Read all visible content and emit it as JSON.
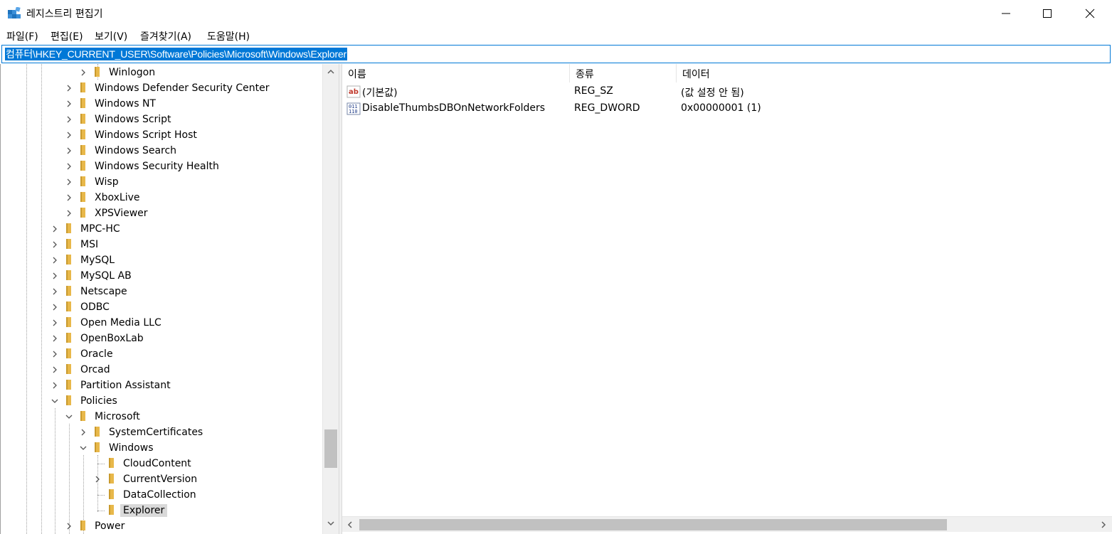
{
  "window": {
    "title": "레지스트리 편집기",
    "controls": {
      "minimize": "minimize-icon",
      "maximize": "maximize-icon",
      "close": "close-icon"
    }
  },
  "menu": [
    "파일(F)",
    "편집(E)",
    "보기(V)",
    "즐겨찾기(A)",
    "도움말(H)"
  ],
  "address": {
    "path": "컴퓨터\\HKEY_CURRENT_USER\\Software\\Policies\\Microsoft\\Windows\\Explorer"
  },
  "tree": {
    "items": [
      {
        "label": "Winlogon",
        "level": 2,
        "expander": "collapsed"
      },
      {
        "label": "Windows Defender Security Center",
        "level": 1,
        "expander": "collapsed"
      },
      {
        "label": "Windows NT",
        "level": 1,
        "expander": "collapsed"
      },
      {
        "label": "Windows Script",
        "level": 1,
        "expander": "collapsed"
      },
      {
        "label": "Windows Script Host",
        "level": 1,
        "expander": "collapsed"
      },
      {
        "label": "Windows Search",
        "level": 1,
        "expander": "collapsed"
      },
      {
        "label": "Windows Security Health",
        "level": 1,
        "expander": "collapsed"
      },
      {
        "label": "Wisp",
        "level": 1,
        "expander": "collapsed"
      },
      {
        "label": "XboxLive",
        "level": 1,
        "expander": "collapsed"
      },
      {
        "label": "XPSViewer",
        "level": 1,
        "expander": "collapsed"
      },
      {
        "label": "MPC-HC",
        "level": 0,
        "expander": "collapsed"
      },
      {
        "label": "MSI",
        "level": 0,
        "expander": "collapsed"
      },
      {
        "label": "MySQL",
        "level": 0,
        "expander": "collapsed"
      },
      {
        "label": "MySQL AB",
        "level": 0,
        "expander": "collapsed"
      },
      {
        "label": "Netscape",
        "level": 0,
        "expander": "collapsed"
      },
      {
        "label": "ODBC",
        "level": 0,
        "expander": "collapsed"
      },
      {
        "label": "Open Media LLC",
        "level": 0,
        "expander": "collapsed"
      },
      {
        "label": "OpenBoxLab",
        "level": 0,
        "expander": "collapsed"
      },
      {
        "label": "Oracle",
        "level": 0,
        "expander": "collapsed"
      },
      {
        "label": "Orcad",
        "level": 0,
        "expander": "collapsed"
      },
      {
        "label": "Partition Assistant",
        "level": 0,
        "expander": "collapsed"
      },
      {
        "label": "Policies",
        "level": 0,
        "expander": "expanded"
      },
      {
        "label": "Microsoft",
        "level": 1,
        "expander": "expanded"
      },
      {
        "label": "SystemCertificates",
        "level": 2,
        "expander": "collapsed"
      },
      {
        "label": "Windows",
        "level": 2,
        "expander": "expanded"
      },
      {
        "label": "CloudContent",
        "level": 3,
        "expander": "none"
      },
      {
        "label": "CurrentVersion",
        "level": 3,
        "expander": "collapsed"
      },
      {
        "label": "DataCollection",
        "level": 3,
        "expander": "none"
      },
      {
        "label": "Explorer",
        "level": 3,
        "expander": "none",
        "selected": true
      },
      {
        "label": "Power",
        "level": 1,
        "expander": "collapsed"
      }
    ]
  },
  "list": {
    "columns": [
      "이름",
      "종류",
      "데이터"
    ],
    "rows": [
      {
        "icon": "string-value-icon",
        "name": "(기본값)",
        "type": "REG_SZ",
        "data": "(값 설정 안 됨)"
      },
      {
        "icon": "binary-value-icon",
        "name": "DisableThumbsDBOnNetworkFolders",
        "type": "REG_DWORD",
        "data": "0x00000001 (1)"
      }
    ]
  },
  "colors": {
    "accent": "#0078d7",
    "folder": "#e8b84a",
    "selection": "#d9d9d9"
  }
}
